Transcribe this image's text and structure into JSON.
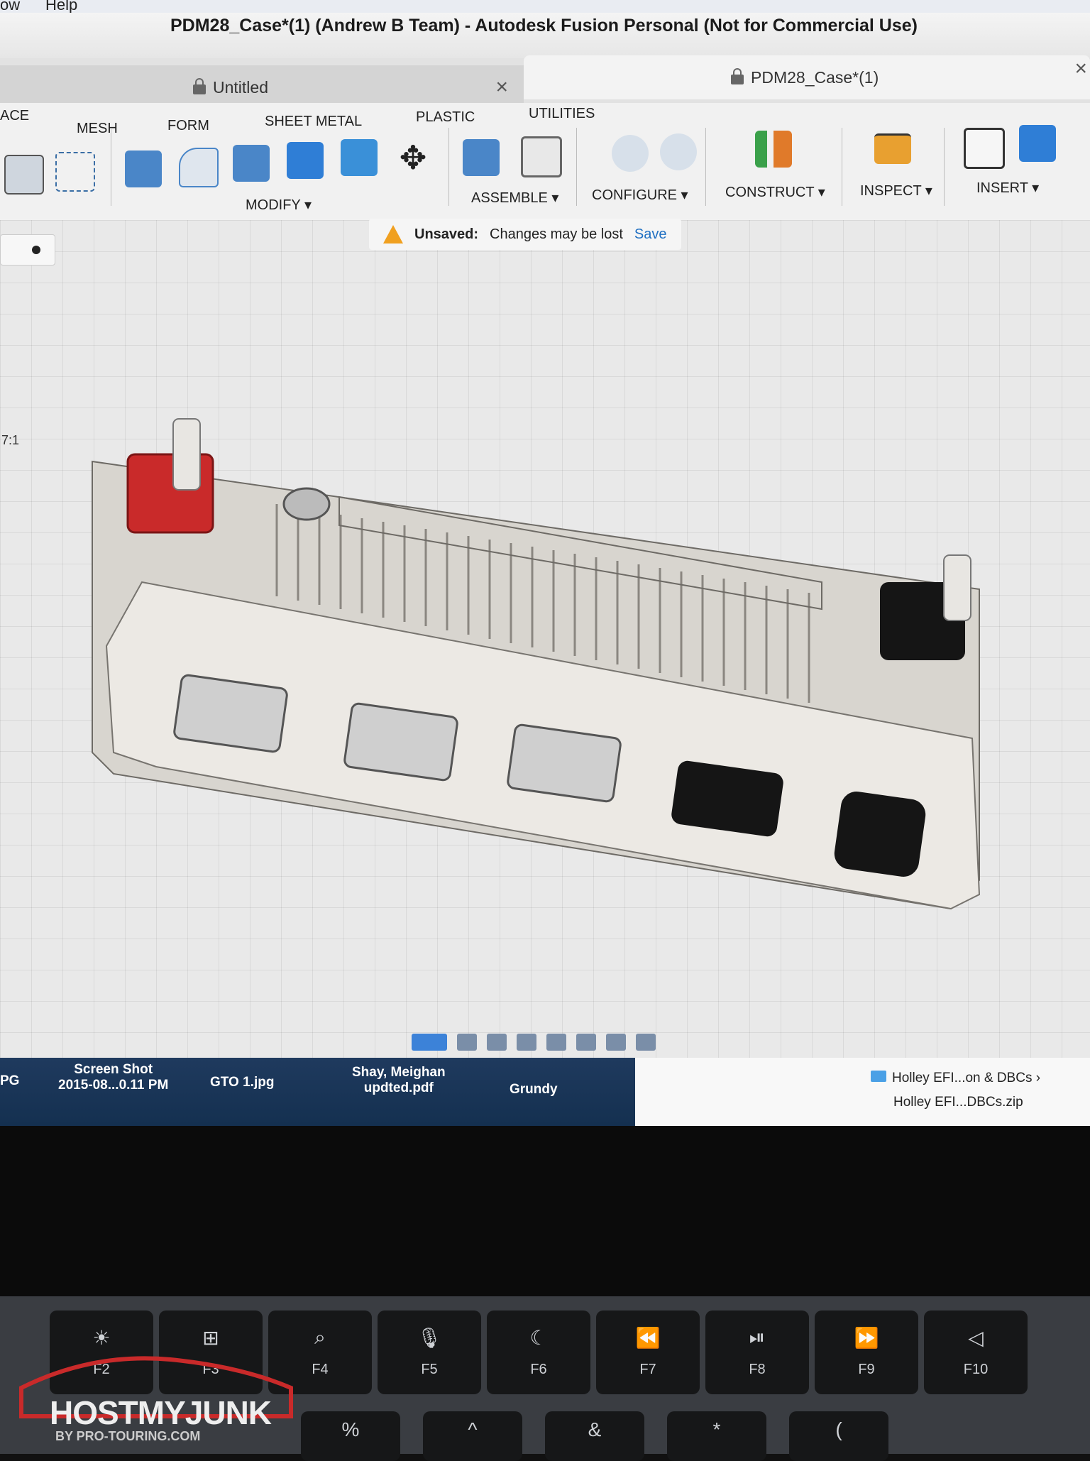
{
  "menubar": {
    "item_window": "ow",
    "item_help": "Help"
  },
  "window_title": "PDM28_Case*(1) (Andrew B Team) - Autodesk Fusion Personal (Not for Commercial Use)",
  "tabs": [
    {
      "label": "Untitled",
      "close": "×"
    },
    {
      "label": "PDM28_Case*(1)",
      "close": "×"
    }
  ],
  "toolbar_tabs": [
    "ACE",
    "MESH",
    "FORM",
    "SHEET METAL",
    "PLASTIC",
    "UTILITIES"
  ],
  "toolbar_groups": [
    "MODIFY ▾",
    "ASSEMBLE ▾",
    "CONFIGURE ▾",
    "CONSTRUCT ▾",
    "INSPECT ▾",
    "INSERT ▾"
  ],
  "notice": {
    "label": "Unsaved:",
    "message": "Changes may be lost",
    "action": "Save"
  },
  "canvas": {
    "zoom_label": "7:1"
  },
  "dock": [
    {
      "line1": "PG",
      "line2": ""
    },
    {
      "line1": "Screen Shot",
      "line2": "2015-08...0.11 PM"
    },
    {
      "line1": "GTO 1.jpg",
      "line2": ""
    },
    {
      "line1": "Shay, Meighan",
      "line2": "updted.pdf"
    },
    {
      "line1": "Grundy",
      "line2": ""
    }
  ],
  "finder": [
    {
      "label": "Holley EFI...on & DBCs",
      "arrow": "›"
    },
    {
      "label": "Holley EFI...DBCs.zip"
    }
  ],
  "fkeys": [
    {
      "glyph": "☀",
      "label": "F2"
    },
    {
      "glyph": "⊞",
      "label": "F3"
    },
    {
      "glyph": "⌕",
      "label": "F4"
    },
    {
      "glyph": "🎙",
      "label": "F5"
    },
    {
      "glyph": "☾",
      "label": "F6"
    },
    {
      "glyph": "⏪",
      "label": "F7"
    },
    {
      "glyph": "⏯",
      "label": "F8"
    },
    {
      "glyph": "⏩",
      "label": "F9"
    },
    {
      "glyph": "◁",
      "label": "F10"
    }
  ],
  "numkeys": [
    "%",
    "^",
    "&",
    "*",
    "("
  ],
  "watermark": {
    "text": "HOSTMYJUNK",
    "sub": "BY PRO-TOURING.COM"
  },
  "colors": {
    "accent": "#1f6fc2",
    "warning": "#f0a020",
    "dock": "#1f3a5e",
    "red_post": "#c92a2a"
  }
}
